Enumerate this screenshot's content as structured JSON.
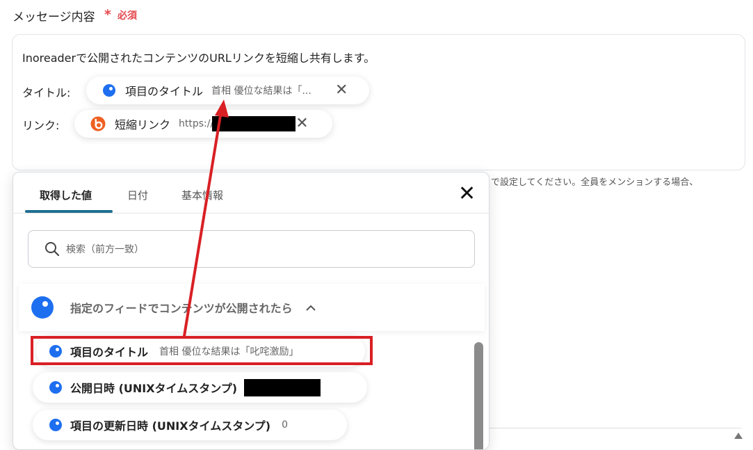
{
  "field": {
    "label": "メッセージ内容",
    "required_mark": "*",
    "required_text": "必須"
  },
  "message": {
    "line1": "Inoreaderで公開されたコンテンツのURLリンクを短縮し共有します。",
    "title_label": "タイトル:",
    "link_label": "リンク:",
    "title_chip": {
      "name": "項目のタイトル",
      "value": "首相 優位な結果は「...",
      "icon": "inoreader-icon"
    },
    "link_chip": {
      "name": "短縮リンク",
      "value": "https://",
      "icon": "bitly-icon"
    }
  },
  "helper_text_tail": "で設定してください。全員をメンションする場合、",
  "popup": {
    "tabs": [
      "取得した値",
      "日付",
      "基本情報"
    ],
    "active_tab": 0,
    "search_placeholder": "検索（前方一致）",
    "group": {
      "label": "指定のフィードでコンテンツが公開されたら",
      "expanded": true
    },
    "items": [
      {
        "name": "項目のタイトル",
        "value": "首相 優位な結果は「叱咤激励」",
        "highlighted": true
      },
      {
        "name": "公開日時 (UNIXタイムスタンプ)",
        "value": "",
        "redacted": true
      },
      {
        "name": "項目の更新日時 (UNIXタイムスタンプ)",
        "value": "0"
      }
    ]
  },
  "colors": {
    "accent_blue": "#1e6ff0",
    "required_red": "#e5484d",
    "highlight_red": "#d92025",
    "tab_underline": "#1f6f93"
  }
}
